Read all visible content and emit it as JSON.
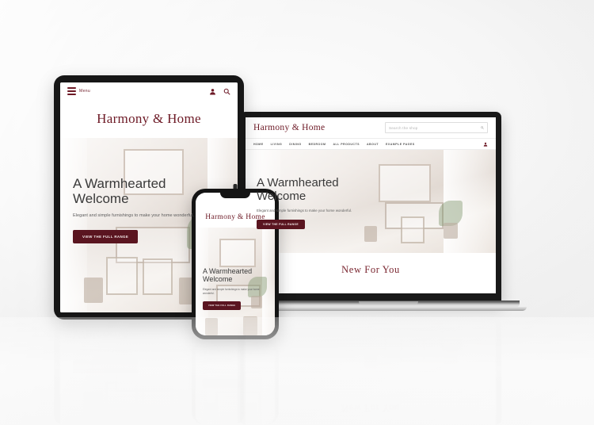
{
  "scene": {
    "description": "Responsive website mockup shown on laptop, tablet and smartphone with floor reflection",
    "background_color": "#ececec",
    "brand_color": "#6d1a26",
    "cta_color": "#5a1520",
    "heading_color": "#3a3a3a"
  },
  "site": {
    "brand": "Harmony & Home",
    "hero": {
      "heading_line1": "A Warmhearted",
      "heading_line2": "Welcome",
      "subtext": "Elegant and simple furnishings to make your home wonderful.",
      "cta_label": "VIEW THE FULL RANGE"
    },
    "section_new": {
      "title": "New For You"
    },
    "search": {
      "placeholder": "Search the shop",
      "icon": "search-icon"
    },
    "nav_items": [
      "HOME",
      "LIVING",
      "DINING",
      "BEDROOM",
      "ALL PRODUCTS",
      "ABOUT",
      "EXAMPLE PAGES"
    ],
    "mobile_menu": {
      "label": "Menu",
      "icon": "hamburger-icon"
    },
    "header_icons": [
      "account-icon",
      "search-icon"
    ],
    "account_icon": "account-icon"
  },
  "devices": {
    "laptop": "laptop-device",
    "tablet": "tablet-device",
    "phone": "phone-device"
  }
}
